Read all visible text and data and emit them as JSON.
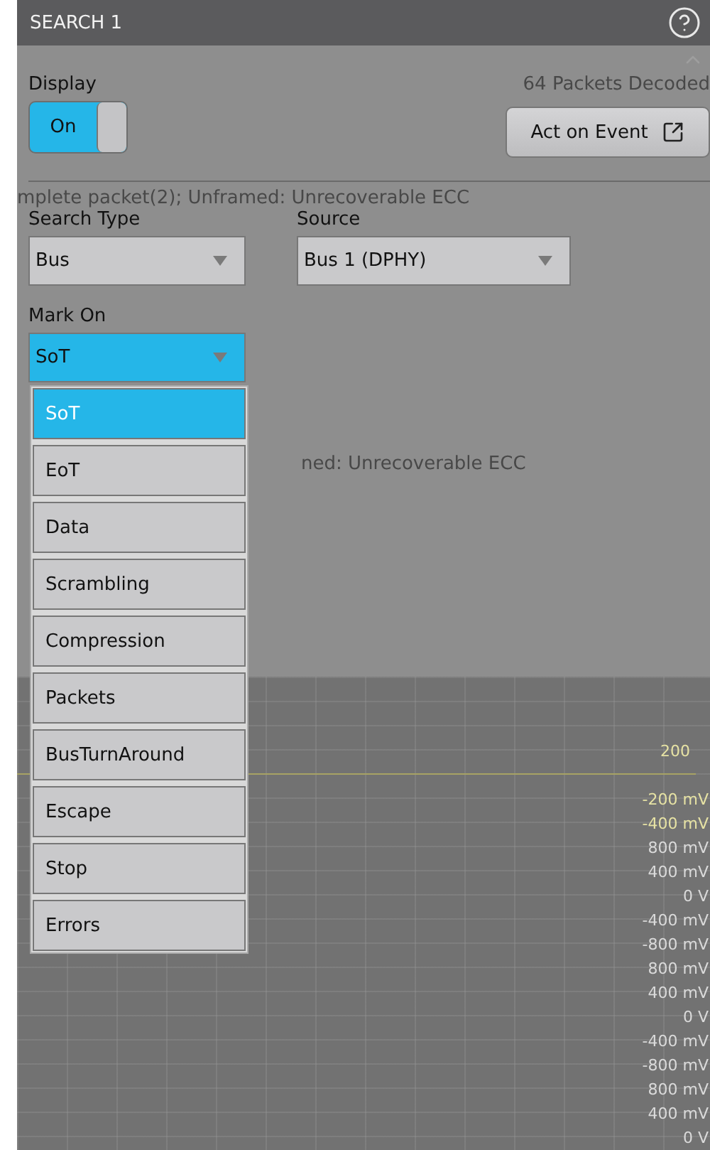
{
  "window": {
    "title": "SEARCH 1"
  },
  "status": "64 Packets Decoded",
  "display": {
    "label": "Display",
    "on": true,
    "state_label": "On"
  },
  "act_button": {
    "label": "Act on Event"
  },
  "background_text": "mplete packet(2); Unframed: Unrecoverable ECC",
  "background_text_2": "ned: Unrecoverable ECC",
  "search_type": {
    "label": "Search Type",
    "value": "Bus"
  },
  "source": {
    "label": "Source",
    "value": "Bus 1 (DPHY)"
  },
  "mark_on": {
    "label": "Mark On",
    "value": "SoT",
    "expanded": true,
    "options": [
      {
        "label": "SoT",
        "selected": true
      },
      {
        "label": "EoT",
        "selected": false
      },
      {
        "label": "Data",
        "selected": false
      },
      {
        "label": "Scrambling",
        "selected": false
      },
      {
        "label": "Compression",
        "selected": false
      },
      {
        "label": "Packets",
        "selected": false
      },
      {
        "label": "BusTurnAround",
        "selected": false
      },
      {
        "label": "Escape",
        "selected": false
      },
      {
        "label": "Stop",
        "selected": false
      },
      {
        "label": "Errors",
        "selected": false
      }
    ]
  },
  "scope": {
    "top_label": "200",
    "axis_labels": [
      "-200 mV",
      "-400 mV",
      "800 mV",
      "400 mV",
      "0 V",
      "-400 mV",
      "-800 mV",
      "800 mV",
      "400 mV",
      "0 V",
      "-400 mV",
      "-800 mV",
      "800 mV",
      "400 mV",
      "0 V"
    ]
  }
}
